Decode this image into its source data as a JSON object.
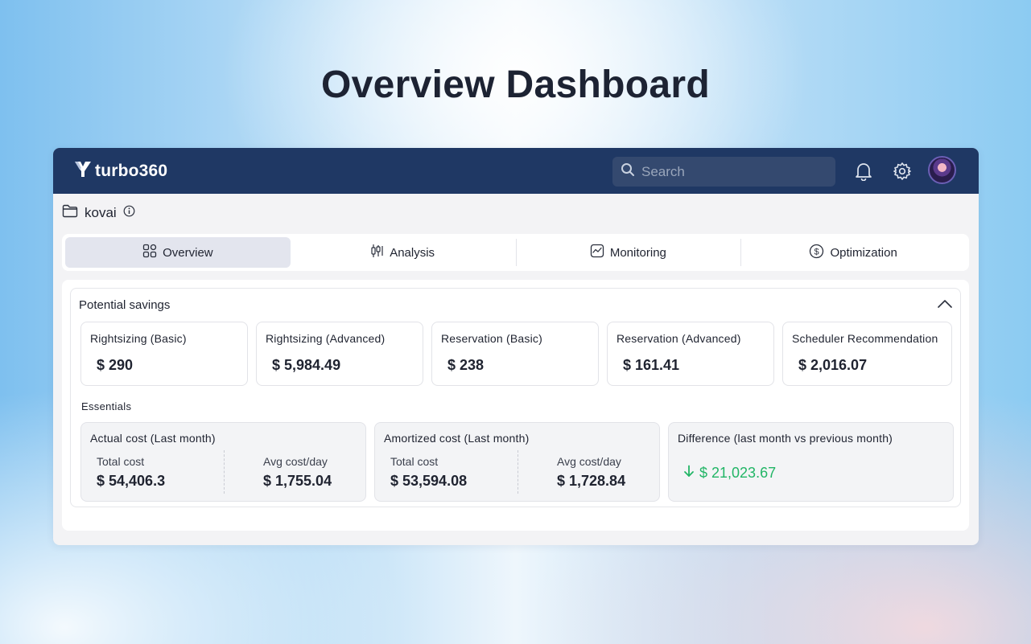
{
  "page": {
    "title": "Overview Dashboard"
  },
  "app": {
    "brand": "turbo360",
    "search": {
      "placeholder": "Search"
    },
    "icons": {
      "bell": "bell-icon",
      "settings": "gear-icon",
      "avatar": "user-avatar"
    }
  },
  "breadcrumb": {
    "label": "kovai"
  },
  "tabs": [
    {
      "label": "Overview",
      "icon": "grid-icon",
      "active": true
    },
    {
      "label": "Analysis",
      "icon": "candlestick-icon",
      "active": false
    },
    {
      "label": "Monitoring",
      "icon": "chart-line-icon",
      "active": false
    },
    {
      "label": "Optimization",
      "icon": "dollar-circle-icon",
      "active": false
    }
  ],
  "savings": {
    "title": "Potential savings",
    "items": [
      {
        "label": "Rightsizing (Basic)",
        "value": "$ 290"
      },
      {
        "label": "Rightsizing (Advanced)",
        "value": "$ 5,984.49"
      },
      {
        "label": "Reservation (Basic)",
        "value": "$ 238"
      },
      {
        "label": "Reservation (Advanced)",
        "value": "$ 161.41"
      },
      {
        "label": "Scheduler Recommendation",
        "value": "$ 2,016.07"
      }
    ]
  },
  "essentials": {
    "title": "Essentials",
    "actual": {
      "title": "Actual cost (Last month)",
      "total_label": "Total cost",
      "total": "$ 54,406.3",
      "avg_label": "Avg cost/day",
      "avg": "$ 1,755.04"
    },
    "amortized": {
      "title": "Amortized cost (Last month)",
      "total_label": "Total cost",
      "total": "$ 53,594.08",
      "avg_label": "Avg cost/day",
      "avg": "$ 1,728.84"
    },
    "difference": {
      "title": "Difference (last month vs previous month)",
      "value": "$ 21,023.67",
      "direction": "down",
      "color": "#22b566"
    }
  },
  "colors": {
    "topbar": "#1f3864",
    "accent_green": "#22b566"
  }
}
